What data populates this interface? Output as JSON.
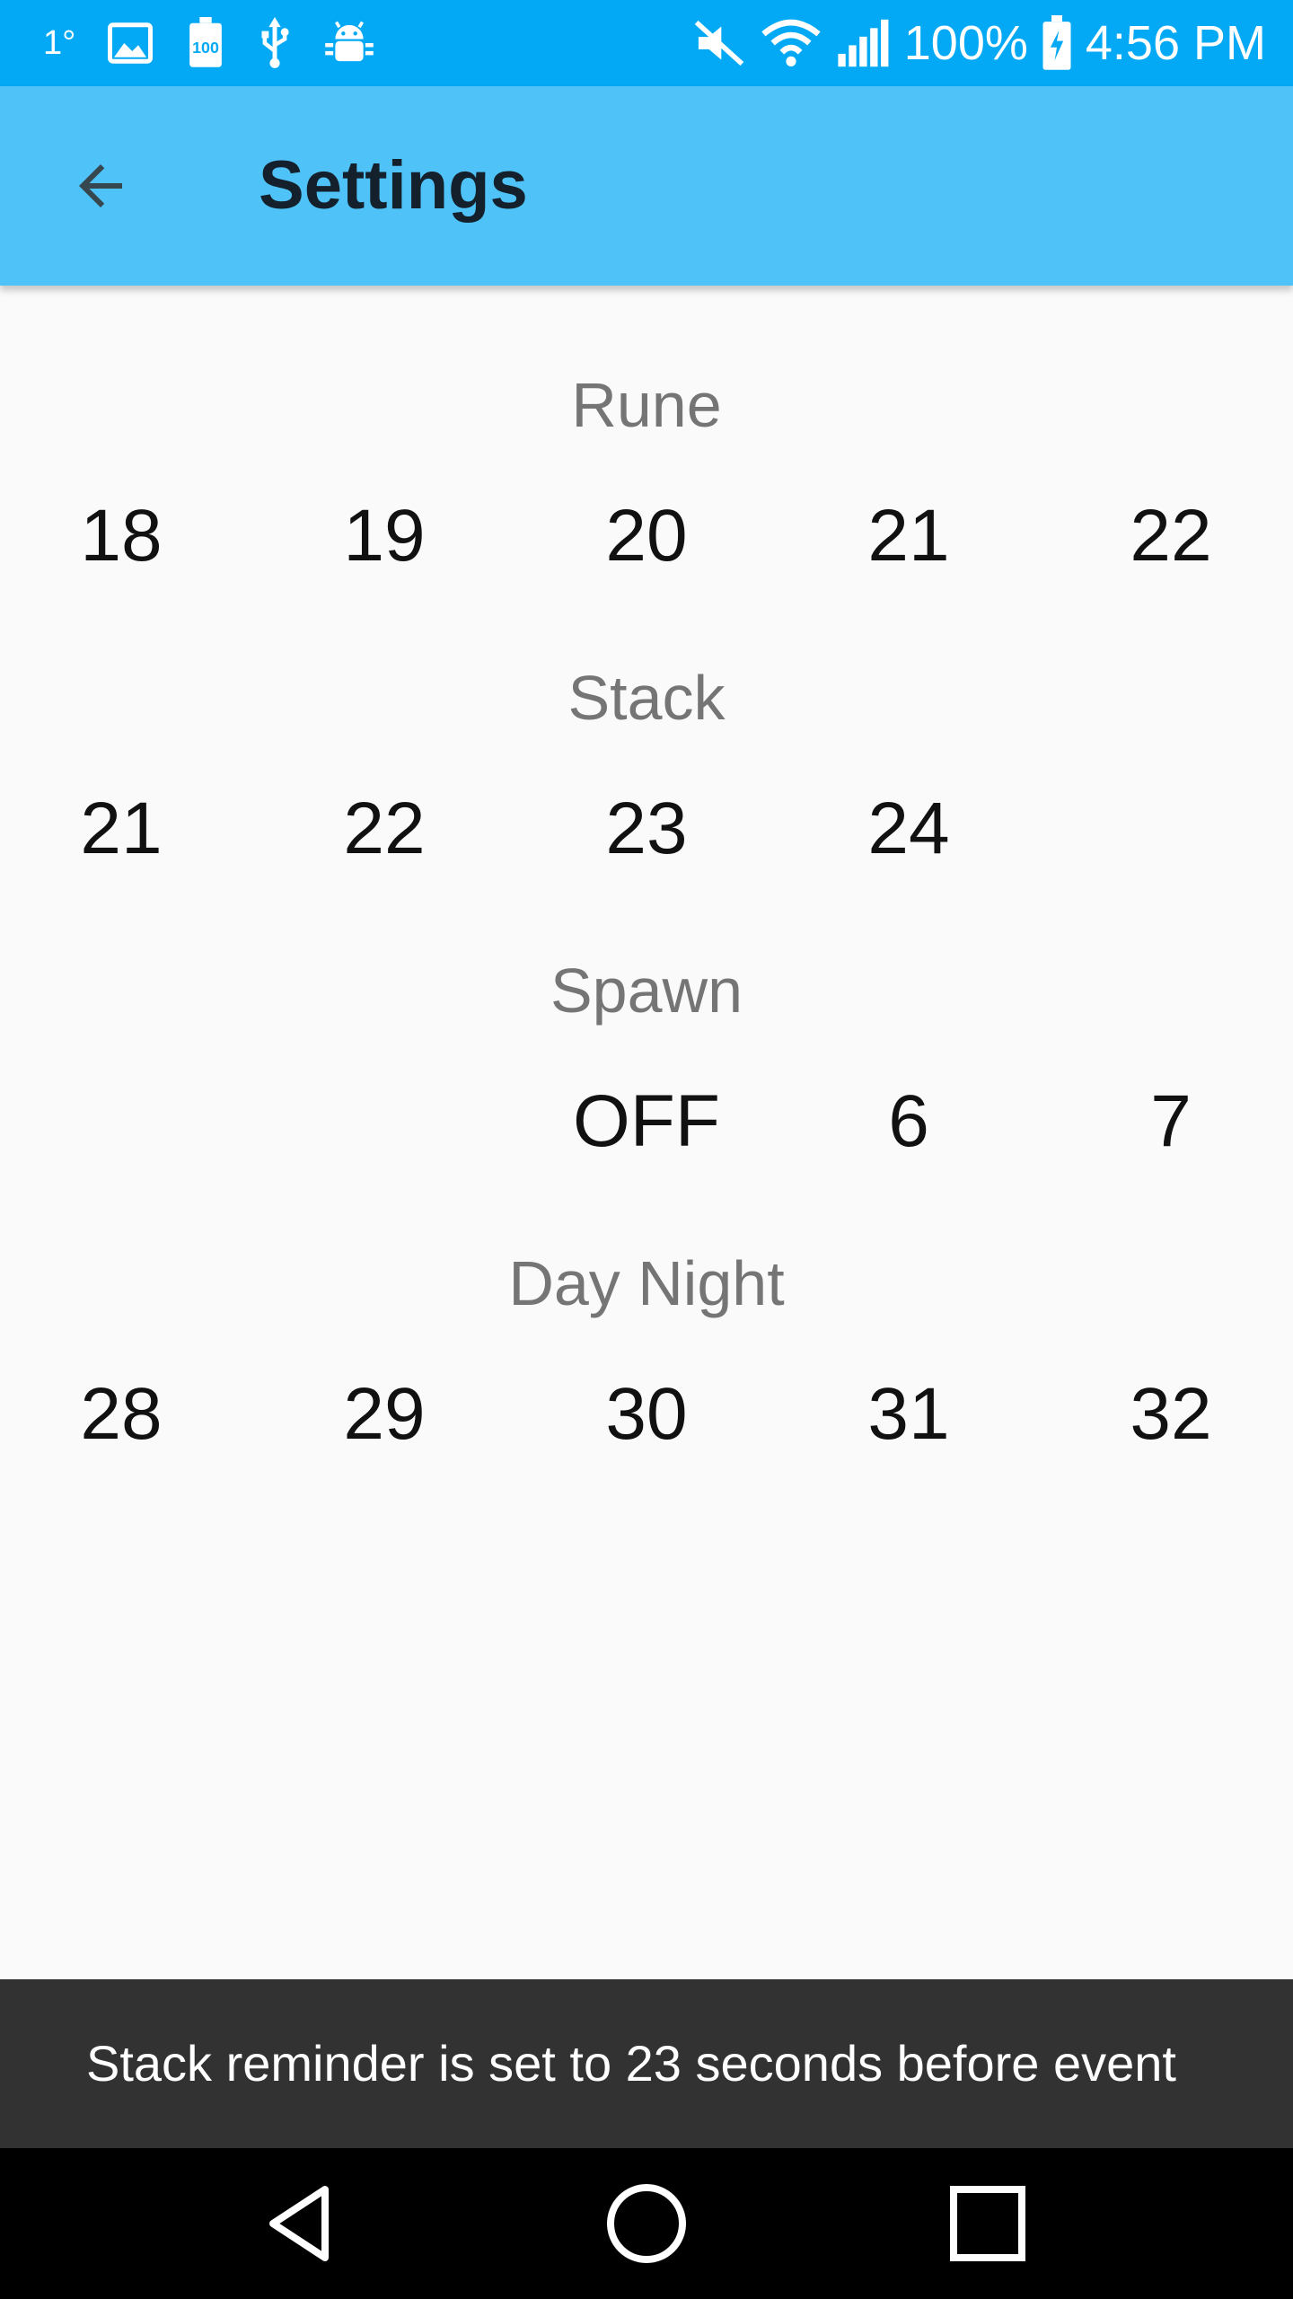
{
  "status_bar": {
    "temperature": "1°",
    "battery_percent": "100%",
    "time": "4:56 PM",
    "background_color": "#03a9f4",
    "left_icons": [
      "image-icon",
      "battery-100-icon",
      "usb-icon",
      "android-debug-icon"
    ],
    "right_icons": [
      "mute-icon",
      "wifi-icon",
      "signal-icon",
      "battery-charging-icon"
    ]
  },
  "toolbar": {
    "title": "Settings",
    "back_icon": "arrow-back-icon",
    "background_color": "#4fc3f7"
  },
  "sections": [
    {
      "title": "Rune",
      "values": [
        "18",
        "19",
        "20",
        "21",
        "22"
      ]
    },
    {
      "title": "Stack",
      "values": [
        "21",
        "22",
        "23",
        "24",
        ""
      ]
    },
    {
      "title": "Spawn",
      "values": [
        "",
        "",
        "OFF",
        "6",
        "7"
      ]
    },
    {
      "title": "Day Night",
      "values": [
        "28",
        "29",
        "30",
        "31",
        "32"
      ]
    }
  ],
  "snackbar": {
    "message": "Stack reminder is set to 23 seconds before event"
  },
  "nav_bar": {
    "icons": [
      "back-triangle-icon",
      "home-circle-icon",
      "recents-square-icon"
    ]
  }
}
